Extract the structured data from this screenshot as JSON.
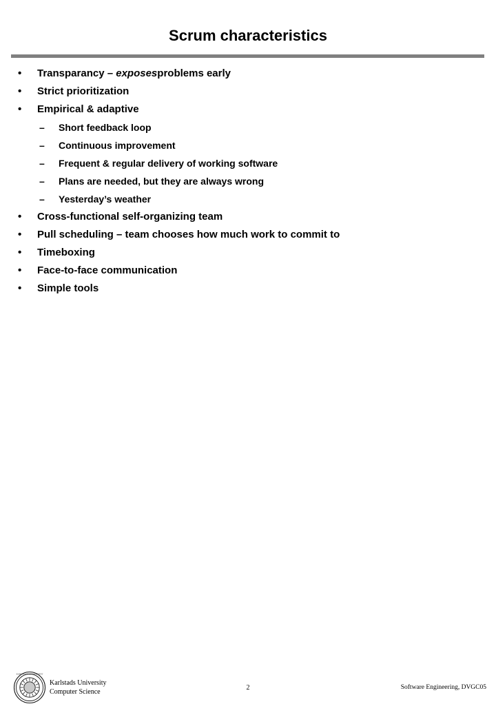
{
  "slide": {
    "title": "Scrum characteristics",
    "rule_color": "#808080",
    "background_color": "#ffffff",
    "text_color": "#000000"
  },
  "bullets": [
    {
      "level": 1,
      "marker": "•",
      "text_prefix": "Transparancy – ",
      "text_emphasis": "exposes",
      "text_suffix": "problems early"
    },
    {
      "level": 1,
      "marker": "•",
      "text": "Strict prioritization"
    },
    {
      "level": 1,
      "marker": "•",
      "text": "Empirical & adaptive"
    },
    {
      "level": 2,
      "marker": "–",
      "text": "Short feedback loop"
    },
    {
      "level": 2,
      "marker": "–",
      "text": "Continuous improvement"
    },
    {
      "level": 2,
      "marker": "–",
      "text": "Frequent & regular delivery of working software"
    },
    {
      "level": 2,
      "marker": "–",
      "text": "Plans are needed, but they are always wrong"
    },
    {
      "level": 2,
      "marker": "–",
      "text": "Yesterday’s weather"
    },
    {
      "level": 1,
      "marker": "•",
      "text": "Cross-functional self-organizing team"
    },
    {
      "level": 1,
      "marker": "•",
      "text": "Pull scheduling – team chooses how much work to commit to"
    },
    {
      "level": 1,
      "marker": "•",
      "text": "Timeboxing"
    },
    {
      "level": 1,
      "marker": "•",
      "text": "Face-to-face communication"
    },
    {
      "level": 1,
      "marker": "•",
      "text": "Simple tools"
    }
  ],
  "footer": {
    "organization_line1": "Karlstads University",
    "organization_line2": "Computer Science",
    "page_number": "2",
    "course": "Software Engineering, DVGC05",
    "logo_name": "karlstad-university-seal"
  }
}
